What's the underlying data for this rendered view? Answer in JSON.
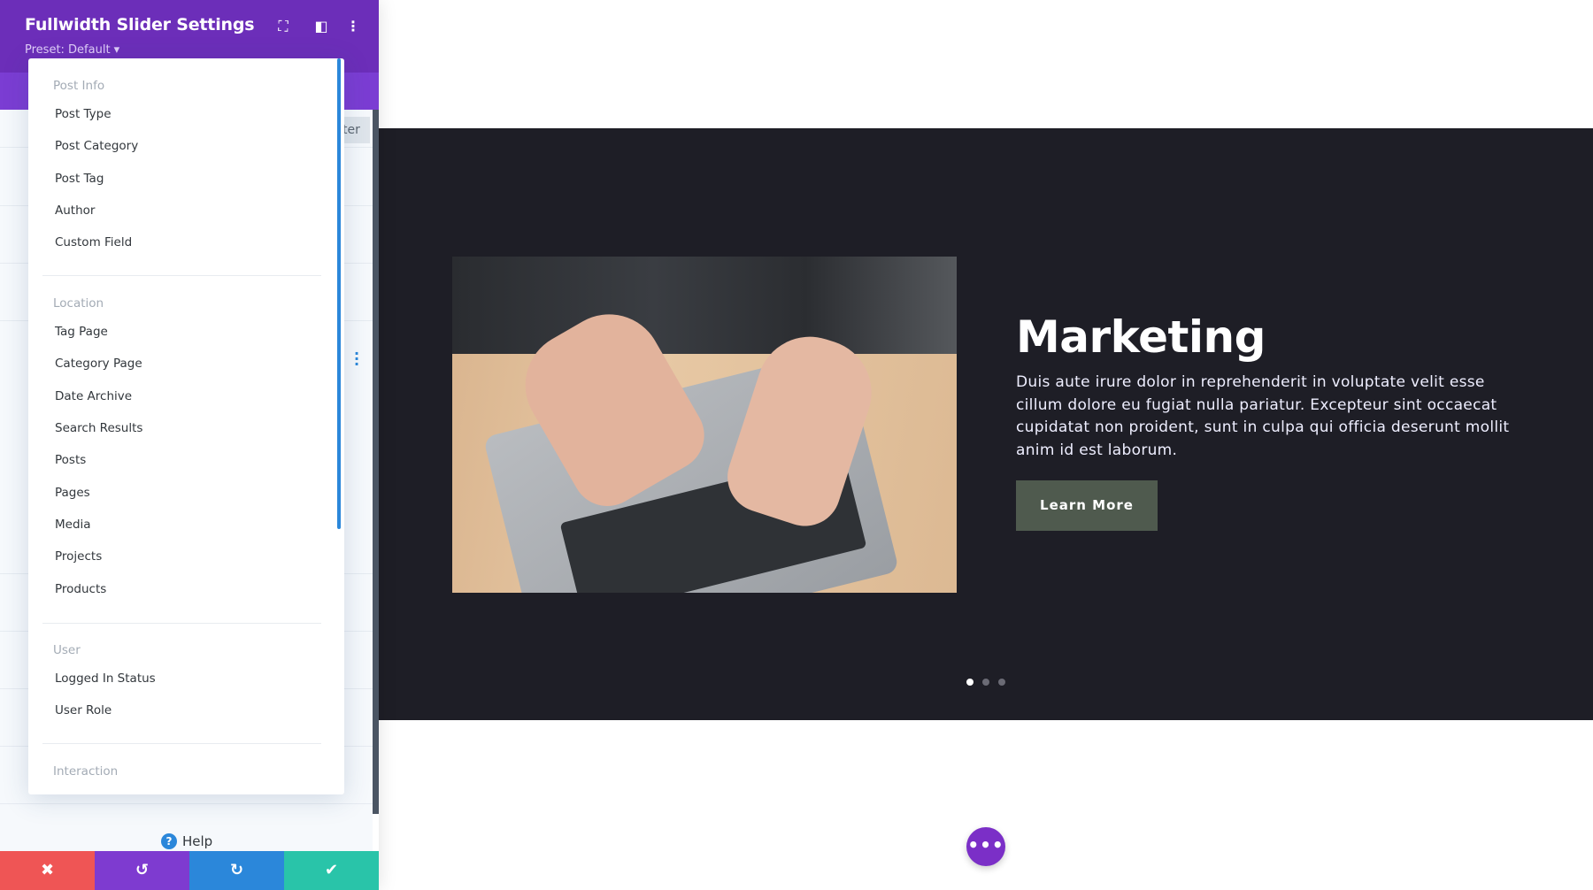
{
  "panel": {
    "title": "Fullwidth Slider Settings",
    "preset": "Preset: Default ▾",
    "tab_partial": "ter",
    "icons": [
      "fullscreen-icon",
      "sidebar-layout-icon",
      "more-vertical-icon"
    ],
    "help": "Help",
    "help_icon": "?",
    "footer": [
      {
        "name": "cancel",
        "icon": "✖",
        "color": "#ef5555"
      },
      {
        "name": "undo",
        "icon": "↺",
        "color": "#7e3bd0"
      },
      {
        "name": "redo",
        "icon": "↻",
        "color": "#2b87da"
      },
      {
        "name": "save",
        "icon": "✔",
        "color": "#29c4a9"
      }
    ]
  },
  "dropdown": {
    "groups": [
      {
        "label": "Post Info",
        "items": [
          "Post Type",
          "Post Category",
          "Post Tag",
          "Author",
          "Custom Field"
        ]
      },
      {
        "label": "Location",
        "items": [
          "Tag Page",
          "Category Page",
          "Date Archive",
          "Search Results",
          "Posts",
          "Pages",
          "Media",
          "Projects",
          "Products"
        ]
      },
      {
        "label": "User",
        "items": [
          "Logged In Status",
          "User Role"
        ]
      },
      {
        "label": "Interaction",
        "items": []
      }
    ]
  },
  "slide": {
    "title": "Marketing",
    "text": "Duis aute irure dolor in reprehenderit in voluptate velit esse cillum dolore eu fugiat nulla pariatur. Excepteur sint occaecat cupidatat non proident, sunt in culpa qui officia deserunt mollit anim id est laborum.",
    "button": "Learn More",
    "dots": 3,
    "active_dot": 1,
    "bg": "#1e1e26"
  },
  "fab": "•••",
  "colors": {
    "header": "#6c2eb9",
    "accent": "#2b87da"
  }
}
